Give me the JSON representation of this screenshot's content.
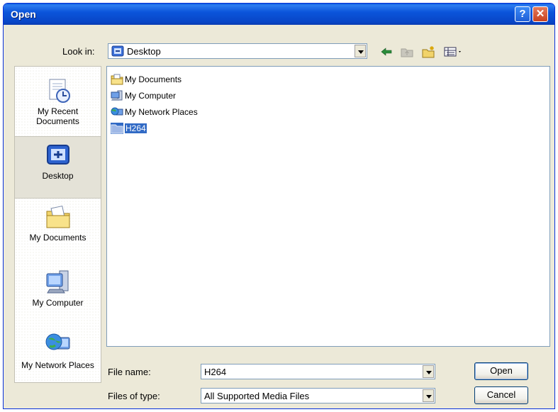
{
  "window": {
    "title": "Open",
    "help_label": "?",
    "close_label": "✕"
  },
  "toolbar": {
    "look_in_label": "Look in:",
    "look_in_value": "Desktop",
    "icons": [
      "back-arrow-icon",
      "up-folder-icon",
      "new-folder-icon",
      "views-menu-icon"
    ]
  },
  "places": [
    {
      "label": "My Recent Documents",
      "icon": "recent-documents-icon",
      "selected": false
    },
    {
      "label": "Desktop",
      "icon": "desktop-icon",
      "selected": true
    },
    {
      "label": "My Documents",
      "icon": "my-documents-icon",
      "selected": false
    },
    {
      "label": "My Computer",
      "icon": "my-computer-icon",
      "selected": false
    },
    {
      "label": "My Network Places",
      "icon": "network-places-icon",
      "selected": false
    }
  ],
  "files": [
    {
      "name": "My Documents",
      "icon": "folder-icon",
      "selected": false
    },
    {
      "name": "My Computer",
      "icon": "computer-icon",
      "selected": false
    },
    {
      "name": "My Network Places",
      "icon": "network-icon",
      "selected": false
    },
    {
      "name": "H264",
      "icon": "folder-icon",
      "selected": true
    }
  ],
  "form": {
    "file_name_label": "File name:",
    "file_name_value": "H264",
    "file_type_label": "Files of type:",
    "file_type_value": "All Supported Media Files"
  },
  "buttons": {
    "open": "Open",
    "cancel": "Cancel"
  },
  "colors": {
    "title_bar": "#0b55db",
    "selection": "#316ac5",
    "dialog_bg": "#ece9d8"
  }
}
